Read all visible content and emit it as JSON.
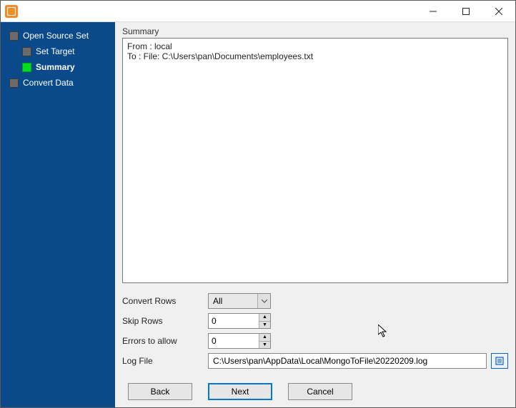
{
  "titlebar": {
    "title": ""
  },
  "sidebar": {
    "items": [
      {
        "label": "Open Source Set",
        "active": false,
        "level": 0
      },
      {
        "label": "Set Target",
        "active": false,
        "level": 1
      },
      {
        "label": "Summary",
        "active": true,
        "level": 1
      },
      {
        "label": "Convert Data",
        "active": false,
        "level": 0
      }
    ]
  },
  "main": {
    "summary_label": "Summary",
    "summary_text": "From : local\nTo : File: C:\\Users\\pan\\Documents\\employees.txt",
    "convert_rows_label": "Convert Rows",
    "convert_rows_value": "All",
    "skip_rows_label": "Skip Rows",
    "skip_rows_value": "0",
    "errors_label": "Errors to allow",
    "errors_value": "0",
    "logfile_label": "Log File",
    "logfile_value": "C:\\Users\\pan\\AppData\\Local\\MongoToFile\\20220209.log"
  },
  "buttons": {
    "back": "Back",
    "next": "Next",
    "cancel": "Cancel"
  }
}
